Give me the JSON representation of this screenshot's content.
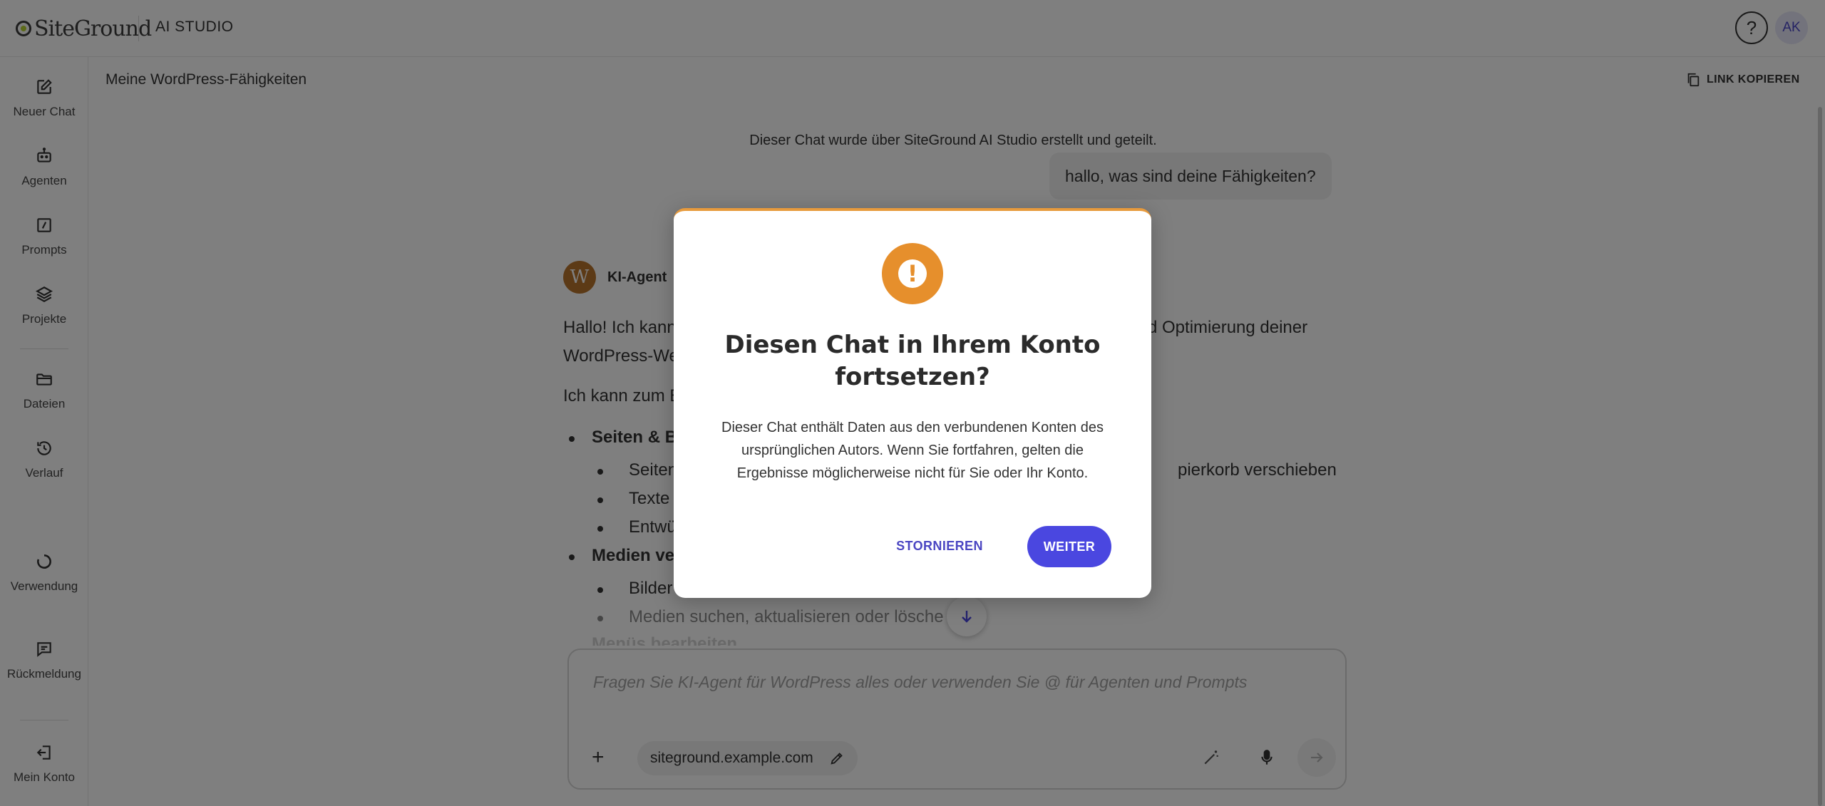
{
  "header": {
    "logo_text": "SiteGround",
    "studio_label": "AI STUDIO",
    "help_icon": "question-circle-icon",
    "avatar_initials": "AK"
  },
  "sidebar": {
    "items": [
      {
        "label": "Neuer Chat",
        "icon": "edit-icon"
      },
      {
        "label": "Agenten",
        "icon": "robot-icon"
      },
      {
        "label": "Prompts",
        "icon": "slash-box-icon"
      },
      {
        "label": "Projekte",
        "icon": "layers-icon"
      },
      {
        "label": "Dateien",
        "icon": "folder-icon"
      },
      {
        "label": "Verlauf",
        "icon": "history-icon"
      },
      {
        "label": "Verwendung",
        "icon": "usage-ring-icon"
      },
      {
        "label": "Rückmeldung",
        "icon": "feedback-icon"
      },
      {
        "label": "Mein Konto",
        "icon": "logout-icon"
      }
    ]
  },
  "main": {
    "chat_title": "Meine WordPress-Fähigkeiten",
    "copy_link_label": "LINK KOPIEREN",
    "shared_note": "Dieser Chat wurde über SiteGround AI Studio erstellt und geteilt.",
    "user_message": "hallo, was sind deine Fähigkeiten?",
    "agent_name": "KI-Agent",
    "answer": {
      "intro_start": "Hallo! Ich kann",
      "intro_end": "d Optimierung deiner",
      "intro_line2": "WordPress-We",
      "example_lead": "Ich kann zum B",
      "section1": "Seiten & Be",
      "s1_item1_start": "Seiten",
      "s1_item1_end": "pierkorb verschieben",
      "s1_item2": "Texte",
      "s1_item3": "Entwü",
      "section2": "Medien ve",
      "s2_item1": "Bilder",
      "s2_item2": "Medien suchen, aktualisieren oder lösche",
      "section3": "Menüs bearbeiten"
    }
  },
  "composer": {
    "placeholder": "Fragen Sie KI-Agent für WordPress alles oder verwenden Sie @ für Agenten und Prompts",
    "site_chip": "siteground.example.com"
  },
  "modal": {
    "title": "Diesen Chat in Ihrem Konto fortsetzen?",
    "body": "Dieser Chat enthält Daten aus den verbundenen Konten des ursprünglichen Autors. Wenn Sie fortfahren, gelten die Ergebnisse möglicherweise nicht für Sie oder Ihr Konto.",
    "cancel_label": "STORNIEREN",
    "continue_label": "WEITER",
    "accent_color": "#e68f2c",
    "button_color": "#4a47e0"
  }
}
